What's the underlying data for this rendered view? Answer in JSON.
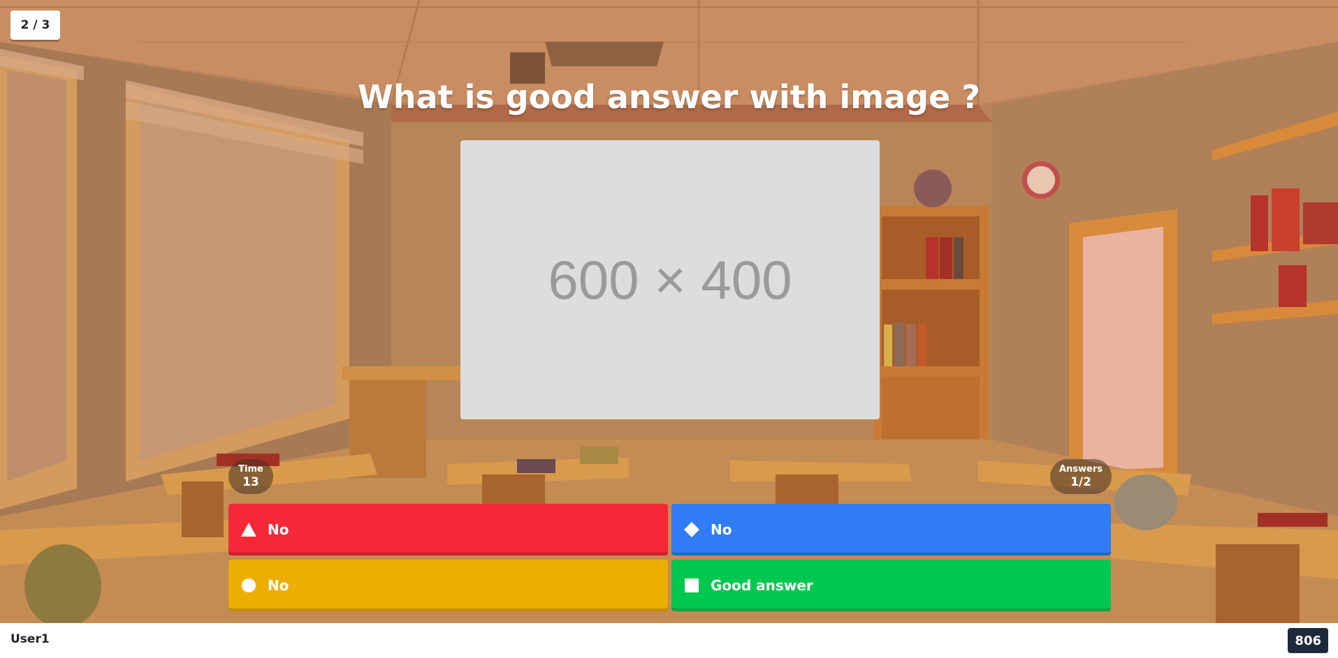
{
  "progress": {
    "text": "2 / 3"
  },
  "question": {
    "title": "What is good answer with image ?"
  },
  "media": {
    "placeholder_text": "600 × 400"
  },
  "stats": {
    "time_label": "Time",
    "time_value": "13",
    "answers_label": "Answers",
    "answers_value": "1/2"
  },
  "answers": [
    {
      "label": "No",
      "shape": "triangle-icon",
      "color": "#f42837"
    },
    {
      "label": "No",
      "shape": "diamond-icon",
      "color": "#2f7cf6"
    },
    {
      "label": "No",
      "shape": "circle-icon",
      "color": "#eeae00"
    },
    {
      "label": "Good answer",
      "shape": "square-icon",
      "color": "#00c74f"
    }
  ],
  "footer": {
    "username": "User1",
    "score": "806"
  }
}
